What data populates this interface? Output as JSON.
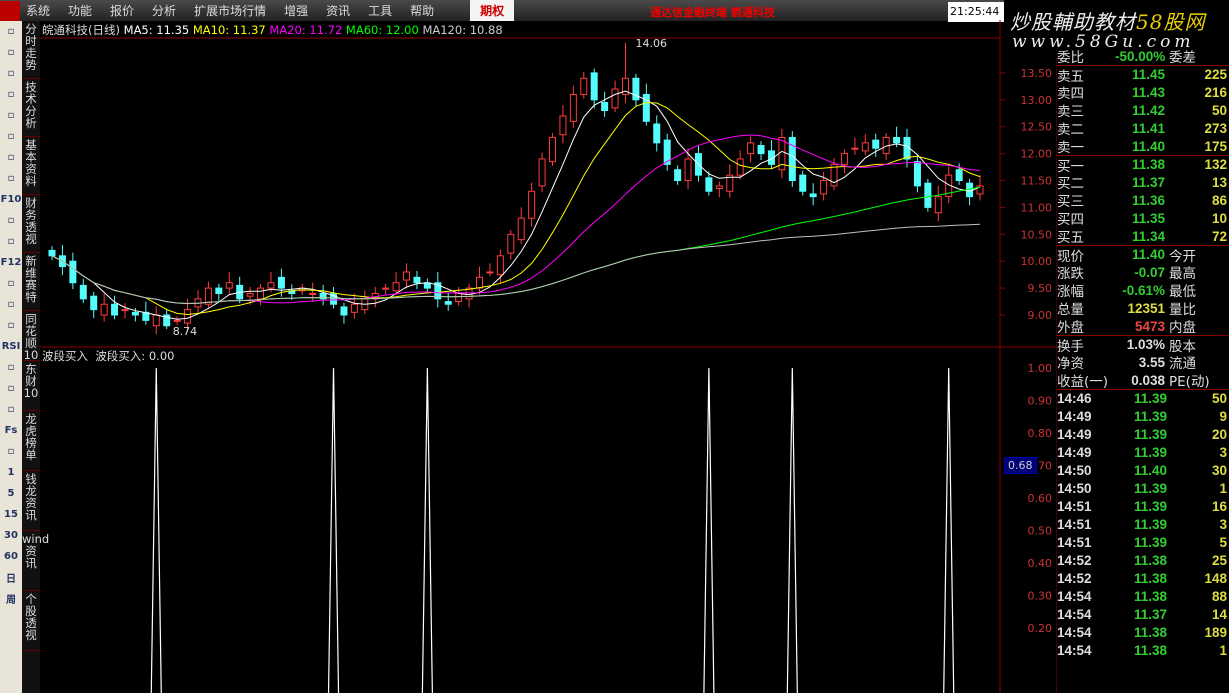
{
  "menu": [
    "系统",
    "功能",
    "报价",
    "分析",
    "扩展市场行情",
    "增强",
    "资讯",
    "工具",
    "帮助"
  ],
  "menu_option": "期权",
  "ad_text": "通达信金融终端  鹤通科技",
  "clock": "21:25:44",
  "watermark": {
    "line1": "炒股輔助教材",
    "line1b": "58股网",
    "line2": "www.58Gu.com"
  },
  "left_icons": [
    "back-icon",
    "up-icon",
    "down-icon",
    "quote-icon",
    "grid-icon",
    "line-chart-icon",
    "candle-icon",
    "list-icon",
    "F10",
    "news-icon",
    "box-icon",
    "F12",
    "map-icon",
    "target-icon",
    "wave-icon",
    "RSI",
    "s-icon",
    "move-icon",
    "pencil-icon",
    "Fs",
    "money-icon",
    "1",
    "5",
    "15",
    "30",
    "60",
    "日",
    "周"
  ],
  "vtabs": [
    "分时走势",
    "技术分析",
    "基本资料",
    "财务透视",
    "新维赛特",
    "同花顺10",
    "东财10",
    "龙虎榜单",
    "钱龙资讯",
    "wind资讯",
    "个股透视"
  ],
  "header": {
    "stock": "皖通科技(日线)",
    "ma5": "MA5: 11.35",
    "ma10": "MA10: 11.37",
    "ma20": "MA20: 11.72",
    "ma60": "MA60: 12.00",
    "ma120": "MA120: 10.88"
  },
  "indicator": {
    "title": "波段买入",
    "value_label": "波段买入: 0.00",
    "current": "0.68"
  },
  "colors": {
    "up": "#ff3c3c",
    "down": "#54fcfc",
    "ma5": "#ffffff",
    "ma10": "#ffff00",
    "ma20": "#ff00ff",
    "ma60": "#00ff00",
    "ma120": "#c0c0c0"
  },
  "chart_data": {
    "type": "candlestick",
    "price_axis": [
      "13.50",
      "13.00",
      "12.50",
      "12.00",
      "11.50",
      "11.00",
      "10.50",
      "10.00",
      "9.50",
      "9.00"
    ],
    "ylim": [
      8.6,
      13.9
    ],
    "annotations": {
      "high": "14.06",
      "low": "8.74"
    },
    "closes": [
      10.1,
      9.9,
      9.6,
      9.3,
      9.1,
      9.2,
      9.0,
      9.1,
      9.0,
      8.9,
      9.0,
      8.8,
      8.9,
      9.1,
      9.3,
      9.5,
      9.4,
      9.6,
      9.3,
      9.4,
      9.5,
      9.6,
      9.5,
      9.4,
      9.5,
      9.4,
      9.3,
      9.2,
      9.0,
      9.2,
      9.3,
      9.4,
      9.5,
      9.6,
      9.8,
      9.6,
      9.5,
      9.3,
      9.2,
      9.4,
      9.5,
      9.7,
      9.8,
      10.1,
      10.5,
      10.8,
      11.3,
      11.9,
      12.3,
      12.7,
      13.1,
      13.4,
      13.0,
      12.8,
      13.2,
      13.4,
      13.0,
      12.6,
      12.2,
      11.8,
      11.5,
      11.9,
      11.6,
      11.3,
      11.4,
      11.6,
      11.9,
      12.2,
      12.0,
      11.8,
      12.3,
      11.5,
      11.3,
      11.2,
      11.5,
      11.8,
      12.0,
      12.1,
      12.2,
      12.1,
      12.3,
      12.2,
      11.9,
      11.4,
      11.0,
      11.2,
      11.6,
      11.5,
      11.2,
      11.4
    ],
    "indicator_axis": [
      "1.00",
      "0.90",
      "0.80",
      "0.70",
      "0.60",
      "0.50",
      "0.40",
      "0.30",
      "0.20"
    ],
    "indicator_spikes_at_candle": [
      10,
      27,
      36,
      63,
      71,
      86
    ],
    "indicator_ylim": [
      0,
      1
    ]
  },
  "quote": {
    "top": {
      "a": "委比",
      "b": "-50.00%",
      "d": "委差"
    },
    "sell": [
      {
        "a": "卖五",
        "b": "11.45",
        "c": "225"
      },
      {
        "a": "卖四",
        "b": "11.43",
        "c": "216"
      },
      {
        "a": "卖三",
        "b": "11.42",
        "c": "50"
      },
      {
        "a": "卖二",
        "b": "11.41",
        "c": "273"
      },
      {
        "a": "卖一",
        "b": "11.40",
        "c": "175"
      }
    ],
    "buy": [
      {
        "a": "买一",
        "b": "11.38",
        "c": "132"
      },
      {
        "a": "买二",
        "b": "11.37",
        "c": "13"
      },
      {
        "a": "买三",
        "b": "11.36",
        "c": "86"
      },
      {
        "a": "买四",
        "b": "11.35",
        "c": "10"
      },
      {
        "a": "买五",
        "b": "11.34",
        "c": "72"
      }
    ],
    "stats": [
      {
        "a": "现价",
        "b": "11.40",
        "d": "今开",
        "cls": "g"
      },
      {
        "a": "涨跌",
        "b": "-0.07",
        "d": "最高",
        "cls": "g"
      },
      {
        "a": "涨幅",
        "b": "-0.61%",
        "d": "最低",
        "cls": "g"
      },
      {
        "a": "总量",
        "b": "12351",
        "d": "量比",
        "cls": "y"
      },
      {
        "a": "外盘",
        "b": "5473",
        "d": "内盘",
        "cls": "r"
      }
    ],
    "fin": [
      {
        "a": "换手",
        "b": "1.03%",
        "d": "股本"
      },
      {
        "a": "净资",
        "b": "3.55",
        "d": "流通"
      },
      {
        "a": "收益(一)",
        "b": "0.038",
        "d": "PE(动)"
      }
    ],
    "ticks": [
      [
        "14:46",
        "11.39",
        "50"
      ],
      [
        "14:49",
        "11.39",
        "9"
      ],
      [
        "14:49",
        "11.39",
        "20"
      ],
      [
        "14:49",
        "11.39",
        "3"
      ],
      [
        "14:50",
        "11.40",
        "30"
      ],
      [
        "14:50",
        "11.39",
        "1"
      ],
      [
        "14:51",
        "11.39",
        "16"
      ],
      [
        "14:51",
        "11.39",
        "3"
      ],
      [
        "14:51",
        "11.39",
        "5"
      ],
      [
        "14:52",
        "11.38",
        "25"
      ],
      [
        "14:52",
        "11.38",
        "148"
      ],
      [
        "14:54",
        "11.38",
        "88"
      ],
      [
        "14:54",
        "11.37",
        "14"
      ],
      [
        "14:54",
        "11.38",
        "189"
      ],
      [
        "14:54",
        "11.38",
        "1"
      ]
    ]
  }
}
